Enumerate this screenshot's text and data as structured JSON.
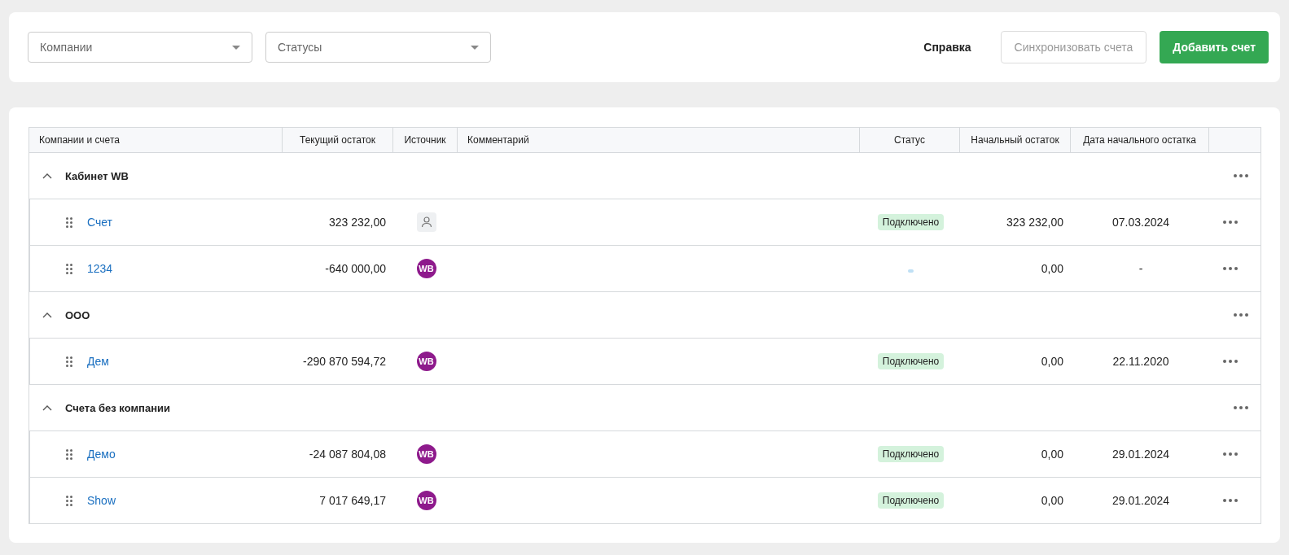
{
  "filters": [
    {
      "placeholder": "Компании"
    },
    {
      "placeholder": "Статусы"
    }
  ],
  "actions": {
    "help": "Справка",
    "sync": {
      "label": "Синхронизовать счета",
      "disabled": true
    },
    "add": "Добавить счет"
  },
  "table": {
    "columns": [
      "Компании и счета",
      "Текущий остаток",
      "Источник",
      "Комментарий",
      "Статус",
      "Начальный остаток",
      "Дата начального остатка"
    ],
    "groups": [
      {
        "name": "Кабинет WB",
        "expanded": true,
        "accounts": [
          {
            "name": "Счет",
            "balance": "323 232,00",
            "source": {
              "kind": "manual"
            },
            "status": {
              "kind": "connected",
              "label": "Подключено"
            },
            "initial": "323 232,00",
            "date": "07.03.2024"
          },
          {
            "name": "1234",
            "balance": "-640 000,00",
            "source": {
              "kind": "badge",
              "label": "WB"
            },
            "status": {
              "kind": "pending"
            },
            "initial": "0,00",
            "date": "-"
          }
        ]
      },
      {
        "name": "ООО",
        "expanded": true,
        "accounts": [
          {
            "name": "Дем",
            "balance": "-290 870 594,72",
            "source": {
              "kind": "badge",
              "label": "WB"
            },
            "status": {
              "kind": "connected",
              "label": "Подключено"
            },
            "initial": "0,00",
            "date": "22.11.2020"
          }
        ]
      },
      {
        "name": "Счета без компании",
        "expanded": true,
        "accounts": [
          {
            "name": "Демо",
            "balance": "-24 087 804,08",
            "source": {
              "kind": "badge",
              "label": "WB"
            },
            "status": {
              "kind": "connected",
              "label": "Подключено"
            },
            "initial": "0,00",
            "date": "29.01.2024"
          },
          {
            "name": "Show",
            "balance": "7 017 649,17",
            "source": {
              "kind": "badge",
              "label": "WB"
            },
            "status": {
              "kind": "connected",
              "label": "Подключено"
            },
            "initial": "0,00",
            "date": "29.01.2024"
          }
        ]
      }
    ]
  }
}
